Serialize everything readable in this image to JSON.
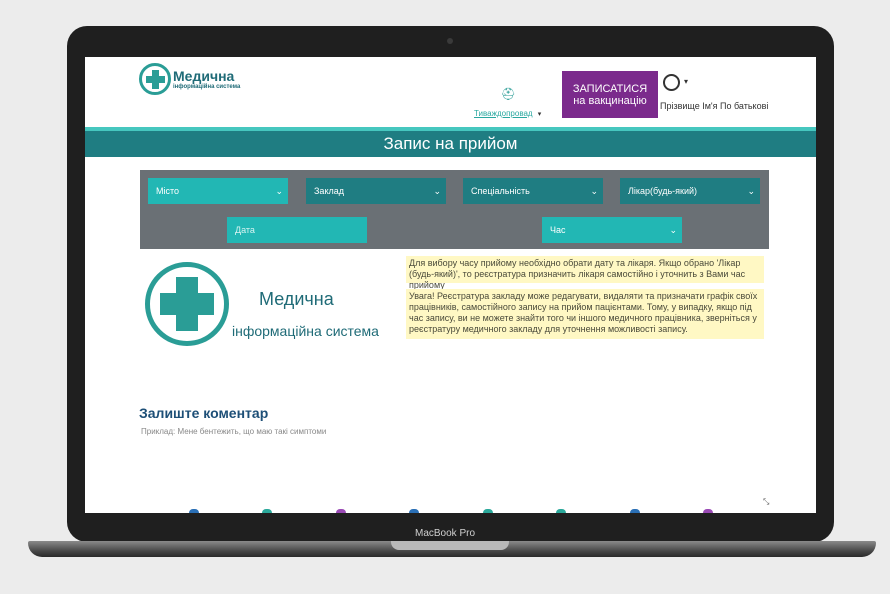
{
  "device": {
    "label": "MacBook Pro"
  },
  "header": {
    "logo_title": "Медична",
    "logo_subtitle": "інформаційна система",
    "doctor_link": "Тиваждопровад",
    "vaccination_button": [
      "ЗАПИСАТИСЯ",
      "на вакцинацію"
    ],
    "user_name": "Прізвище Ім'я По батькові",
    "user_caret": "▾"
  },
  "page_title": "Запис на прийом",
  "filters": {
    "city": "Місто",
    "facility": "Заклад",
    "specialty": "Спеціальність",
    "doctor": "Лікар(будь-який)",
    "date_placeholder": "Дата",
    "time": "Час",
    "chevron": "⌄"
  },
  "notes": {
    "note1": "Для вибору часу прийому необхідно обрати дату та лікаря. Якщо обрано 'Лікар (будь-який)', то реєстратура призначить лікаря самостійно і уточнить з Вами час прийому",
    "note2": "Увага! Реєстратура закладу може редагувати, видаляти та призначати графік своїх працівників, самостійного запису на прийом пацієнтами. Тому, у випадку, якщо під час запису, ви не можете знайти того чи іншого медичного працівника, зверніться у реєстратуру медичного закладу для уточнення можливості запису."
  },
  "brand": {
    "title": "Медична",
    "subtitle": "інформаційна система"
  },
  "comment": {
    "title": "Залиште коментар",
    "placeholder": "Приклад: Мене бентежить, що маю такі симптоми"
  },
  "colors": {
    "teal": "#22b7b4",
    "dark_teal": "#1f7d82",
    "purple": "#7b2a8c",
    "note_bg": "#fff8c4"
  }
}
